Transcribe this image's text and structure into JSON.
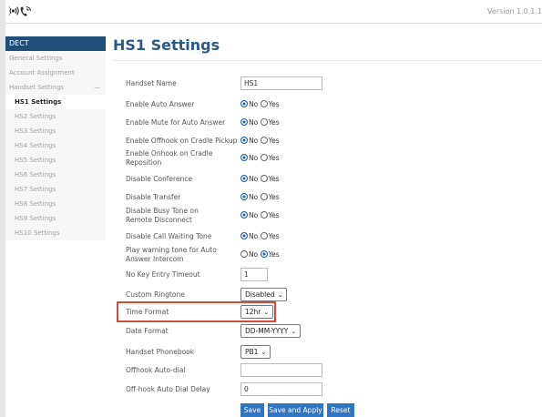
{
  "header": {
    "version": "Version 1.0.1.1"
  },
  "sidebar": {
    "section": "DECT",
    "items": [
      {
        "label": "General Settings"
      },
      {
        "label": "Account Assignment"
      },
      {
        "label": "Handset Settings",
        "collapse": "—"
      },
      {
        "label": "HS1 Settings"
      },
      {
        "label": "HS2 Settings"
      },
      {
        "label": "HS3 Settings"
      },
      {
        "label": "HS4 Settings"
      },
      {
        "label": "HS5 Settings"
      },
      {
        "label": "HS6 Settings"
      },
      {
        "label": "HS7 Settings"
      },
      {
        "label": "HS8 Settings"
      },
      {
        "label": "HS9 Settings"
      },
      {
        "label": "HS10 Settings"
      }
    ]
  },
  "page": {
    "title": "HS1 Settings"
  },
  "radio_labels": {
    "no": "No",
    "yes": "Yes"
  },
  "form": {
    "handset_name": {
      "label": "Handset Name",
      "value": "HS1"
    },
    "auto_answer": {
      "label": "Enable Auto Answer",
      "selected": "No"
    },
    "mute_auto_answer": {
      "label": "Enable Mute for Auto Answer",
      "selected": "No"
    },
    "offhook_cradle": {
      "label": "Enable Offhook on Cradle Pickup",
      "selected": "No"
    },
    "onhook_cradle": {
      "label": "Enable Onhook on Cradle Reposition",
      "selected": "No"
    },
    "disable_conference": {
      "label": "Disable Conference",
      "selected": "No"
    },
    "disable_transfer": {
      "label": "Disable Transfer",
      "selected": "No"
    },
    "busy_tone": {
      "label": "Disable Busy Tone on Remote Disconnect",
      "selected": "No"
    },
    "call_waiting_tone": {
      "label": "Disable Call Waiting Tone",
      "selected": "No"
    },
    "warning_tone": {
      "label": "Play warning tone for Auto Answer Intercom",
      "selected": "Yes"
    },
    "no_key_timeout": {
      "label": "No Key Entry Timeout",
      "value": "1"
    },
    "ringtone": {
      "label": "Custom Ringtone",
      "value": "Disabled"
    },
    "time_format": {
      "label": "Time Format",
      "value": "12hr"
    },
    "date_format": {
      "label": "Date Format",
      "value": "DD-MM-YYYY"
    },
    "phonebook": {
      "label": "Handset Phonebook",
      "value": "PB1"
    },
    "offhook_auto_dial": {
      "label": "Offhook Auto-dial",
      "value": ""
    },
    "auto_dial_delay": {
      "label": "Off-hook Auto Dial Delay",
      "value": "0"
    }
  },
  "buttons": {
    "save": "Save",
    "save_apply": "Save and Apply",
    "reset": "Reset"
  },
  "colors": {
    "accent": "#2e75c4",
    "sidebar_header": "#1f4e79",
    "highlight": "#d64a3e"
  }
}
